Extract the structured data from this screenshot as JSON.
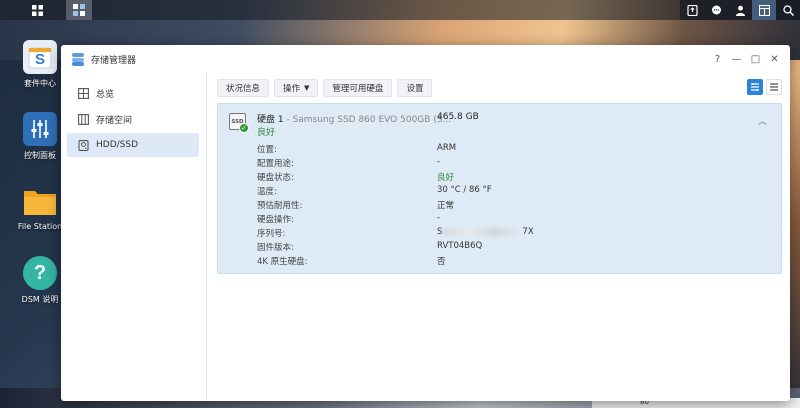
{
  "taskbar": {
    "left_buttons": [
      {
        "icon": "apps-grid-icon"
      },
      {
        "icon": "storage-manager-task-icon"
      }
    ],
    "right_buttons": [
      {
        "icon": "upload-tray-icon"
      },
      {
        "icon": "chat-icon"
      },
      {
        "icon": "user-icon"
      },
      {
        "icon": "widgets-icon"
      },
      {
        "icon": "search-icon"
      }
    ]
  },
  "desktop": {
    "icons": [
      {
        "label": "套件中心",
        "icon": "package-center-icon",
        "color": "#e8eef5"
      },
      {
        "label": "控制面板",
        "icon": "control-panel-icon",
        "color": "#2f6fb8"
      },
      {
        "label": "File Station",
        "icon": "folder-icon",
        "color": "#f3a21e"
      },
      {
        "label": "DSM 说明",
        "icon": "help-icon",
        "color": "#35b6a4"
      }
    ]
  },
  "window": {
    "title": "存储管理器",
    "controls": [
      "?",
      "—",
      "□",
      "✕"
    ]
  },
  "sidebar": {
    "items": [
      {
        "label": "总览",
        "icon": "overview-icon"
      },
      {
        "label": "存储空间",
        "icon": "storage-pool-icon"
      },
      {
        "label": "HDD/SSD",
        "icon": "hdd-icon",
        "active": true
      }
    ]
  },
  "toolbar": {
    "buttons": [
      {
        "label": "状况信息"
      },
      {
        "label": "操作",
        "dropdown": true
      },
      {
        "label": "管理可用硬盘"
      },
      {
        "label": "设置"
      }
    ]
  },
  "disk": {
    "name": "硬盘 1",
    "model": " - Samsung SSD 860 EVO 500GB (S...",
    "size": "465.8 GB",
    "status": "良好",
    "icon_text": "SSD",
    "properties": [
      {
        "key": "位置:",
        "value": "ARM"
      },
      {
        "key": "配置用途:",
        "value": "-"
      },
      {
        "key": "硬盘状态:",
        "value": "良好",
        "status": "good"
      },
      {
        "key": "温度:",
        "value": "30 °C / 86 °F"
      },
      {
        "key": "预估耐用性:",
        "value": "正常"
      },
      {
        "key": "硬盘操作:",
        "value": "-"
      },
      {
        "key": "序列号:",
        "value_prefix": "S",
        "value_suffix": "7X"
      },
      {
        "key": "固件版本:",
        "value": "RVT04B6Q"
      },
      {
        "key": "4K 原生硬盘:",
        "value": "否"
      }
    ]
  },
  "widget": {
    "text": "80"
  },
  "colors": {
    "accent": "#2a84d8",
    "selection": "#deebf7",
    "good": "#2f8a3a"
  }
}
